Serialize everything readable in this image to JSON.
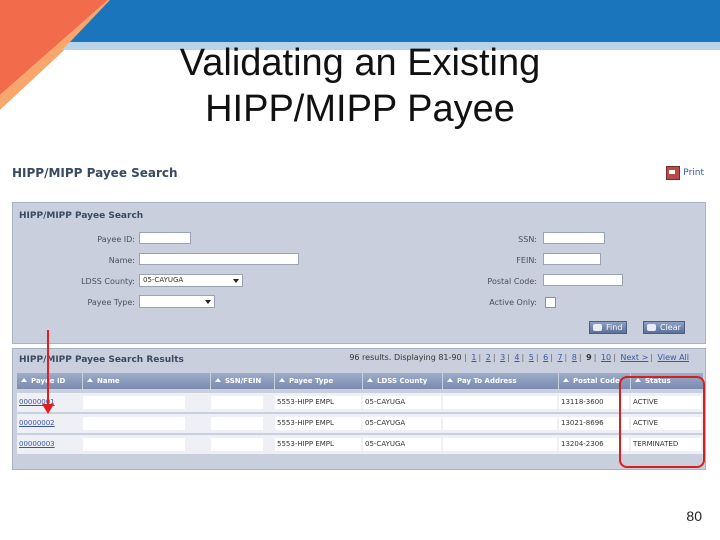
{
  "slide": {
    "title_line1": "Validating an Existing",
    "title_line2": "HIPP/MIPP Payee",
    "page_number": "80",
    "accent_colors": [
      "#f26b4b",
      "#f7a66c",
      "#1a75bc",
      "#b9d4ea"
    ]
  },
  "app": {
    "title": "HIPP/MIPP Payee Search",
    "print_label": "Print",
    "print_icon": "printer-icon"
  },
  "search_panel": {
    "heading": "HIPP/MIPP Payee Search",
    "fields": {
      "payee_id": {
        "label": "Payee ID:",
        "value": ""
      },
      "name": {
        "label": "Name:",
        "value": ""
      },
      "ldss_county": {
        "label": "LDSS County:",
        "value": "05-CAYUGA"
      },
      "payee_type": {
        "label": "Payee Type:",
        "value": ""
      },
      "ssn": {
        "label": "SSN:",
        "value": ""
      },
      "fein": {
        "label": "FEIN:",
        "value": ""
      },
      "postal_code": {
        "label": "Postal Code:",
        "value": ""
      },
      "active_only": {
        "label": "Active Only:",
        "checked": false
      }
    },
    "find_label": "Find",
    "clear_label": "Clear"
  },
  "results_panel": {
    "heading": "HIPP/MIPP Payee Search Results",
    "summary": "96 results. Displaying 81-90",
    "pages": [
      "1",
      "2",
      "3",
      "4",
      "5",
      "6",
      "7",
      "8",
      "9",
      "10"
    ],
    "current_page": "9",
    "next_label": "Next >",
    "view_all_label": "View All",
    "columns": [
      "Payee ID",
      "Name",
      "SSN/FEIN",
      "Payee Type",
      "LDSS County",
      "Pay To Address",
      "Postal Code",
      "Status"
    ],
    "rows": [
      {
        "payee_id": "00000001",
        "name": "",
        "ssn_fein": "",
        "payee_type": "5553-HIPP EMPL",
        "ldss_county": "05-CAYUGA",
        "pay_to_address": "",
        "postal_code": "13118-3600",
        "status": "ACTIVE"
      },
      {
        "payee_id": "00000002",
        "name": "",
        "ssn_fein": "",
        "payee_type": "5553-HIPP EMPL",
        "ldss_county": "05-CAYUGA",
        "pay_to_address": "",
        "postal_code": "13021-8696",
        "status": "ACTIVE"
      },
      {
        "payee_id": "00000003",
        "name": "",
        "ssn_fein": "",
        "payee_type": "5553-HIPP EMPL",
        "ldss_county": "05-CAYUGA",
        "pay_to_address": "",
        "postal_code": "13204-2306",
        "status": "TERMINATED"
      }
    ]
  }
}
